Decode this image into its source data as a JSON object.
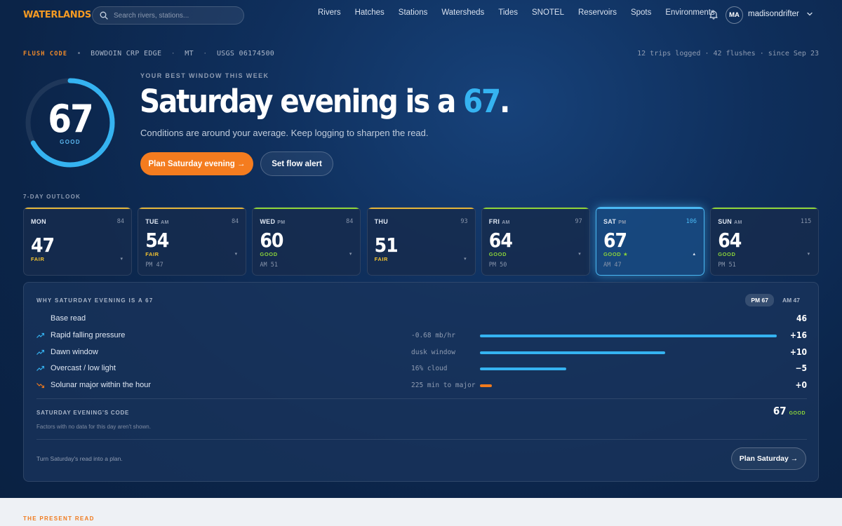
{
  "nav": {
    "logo": "WATERLANDS",
    "search_placeholder": "Search rivers, stations...",
    "links": [
      "Rivers",
      "Hatches",
      "Stations",
      "Watersheds",
      "Tides",
      "SNOTEL",
      "Reservoirs",
      "Spots",
      "Environments"
    ],
    "bell_icon": "bell-icon",
    "avatar_initials": "MA",
    "username": "madisondrifter"
  },
  "hero": {
    "flush_code_label": "FLUSH CODE",
    "location": [
      "BOWDOIN CRP EDGE",
      "MT",
      "USGS 06174500"
    ],
    "stats": "12 trips logged · 42 flushes · since Sep 23",
    "score": "67",
    "score_label": "GOOD",
    "score_fraction": 0.67,
    "kicker": "YOUR BEST WINDOW THIS WEEK",
    "headline_pre": "Saturday evening is a ",
    "headline_num": "67",
    "headline_post": ".",
    "subline": "Conditions are around your average. Keep logging to sharpen the read.",
    "primary_button": "Plan Saturday evening →",
    "secondary_button": "Set flow alert"
  },
  "outlook": {
    "label": "7-DAY OUTLOOK",
    "days": [
      {
        "day": "MON",
        "period": "",
        "flow": "84",
        "score": "47",
        "rating": "FAIR",
        "alt": "",
        "color": "#e0b43a",
        "caret": "▾"
      },
      {
        "day": "TUE",
        "period": "AM",
        "flow": "84",
        "score": "54",
        "rating": "FAIR",
        "alt": "PM 47",
        "color": "#e0b43a",
        "caret": "▾"
      },
      {
        "day": "WED",
        "period": "PM",
        "flow": "84",
        "score": "60",
        "rating": "GOOD",
        "alt": "AM 51",
        "color": "#8bd43a",
        "caret": "▾"
      },
      {
        "day": "THU",
        "period": "",
        "flow": "93",
        "score": "51",
        "rating": "FAIR",
        "alt": "",
        "color": "#e0b43a",
        "caret": "▾"
      },
      {
        "day": "FRI",
        "period": "AM",
        "flow": "97",
        "score": "64",
        "rating": "GOOD",
        "alt": "PM 50",
        "color": "#8bd43a",
        "caret": "▾"
      },
      {
        "day": "SAT",
        "period": "PM",
        "flow": "106",
        "score": "67",
        "rating": "GOOD ★",
        "alt": "AM 47",
        "color": "#4ab8f3",
        "caret": "▴",
        "active": true
      },
      {
        "day": "SUN",
        "period": "AM",
        "flow": "115",
        "score": "64",
        "rating": "GOOD",
        "alt": "PM 51",
        "color": "#8bd43a",
        "caret": "▾"
      }
    ]
  },
  "breakdown": {
    "title": "WHY SATURDAY EVENING IS A 67",
    "toggle": [
      "PM 67",
      "AM 47"
    ],
    "factors": [
      {
        "label": "Base read",
        "metric": "",
        "value": "46",
        "fill": 0,
        "icon": "",
        "color": "#35b3f1"
      },
      {
        "label": "Rapid falling pressure",
        "metric": "-0.68 mb/hr",
        "value": "+16",
        "fill": 1.0,
        "icon": "trend-up-icon",
        "color": "#35b3f1"
      },
      {
        "label": "Dawn window",
        "metric": "dusk window",
        "value": "+10",
        "fill": 0.625,
        "icon": "trend-up-icon",
        "color": "#35b3f1"
      },
      {
        "label": "Overcast / low light",
        "metric": "16% cloud",
        "value": "−5",
        "fill": 0.29,
        "icon": "trend-up-icon",
        "color": "#35b3f1"
      },
      {
        "label": "Solunar major within the hour",
        "metric": "225 min to major",
        "value": "+0",
        "fill": 0.04,
        "icon": "trend-down-icon",
        "color": "#f07a1d"
      }
    ],
    "code_label": "SATURDAY EVENING'S CODE",
    "code_note": "Factors with no data for this day aren't shown.",
    "code_value": "67",
    "code_rating": "GOOD",
    "plan_note": "Turn Saturday's read into a plan.",
    "plan_button": "Plan Saturday →"
  },
  "present": {
    "label": "THE PRESENT READ"
  }
}
